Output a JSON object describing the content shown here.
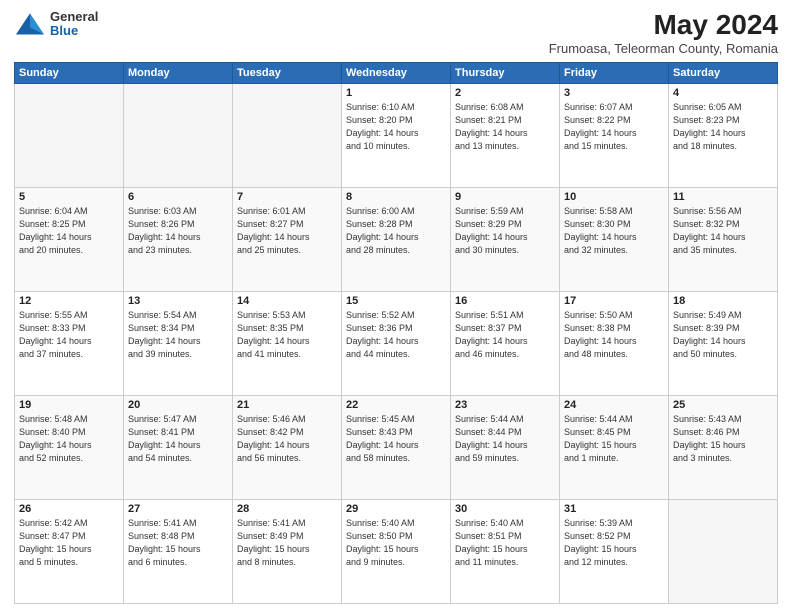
{
  "logo": {
    "general": "General",
    "blue": "Blue"
  },
  "header": {
    "month": "May 2024",
    "location": "Frumoasa, Teleorman County, Romania"
  },
  "weekdays": [
    "Sunday",
    "Monday",
    "Tuesday",
    "Wednesday",
    "Thursday",
    "Friday",
    "Saturday"
  ],
  "weeks": [
    [
      {
        "day": "",
        "info": ""
      },
      {
        "day": "",
        "info": ""
      },
      {
        "day": "",
        "info": ""
      },
      {
        "day": "1",
        "info": "Sunrise: 6:10 AM\nSunset: 8:20 PM\nDaylight: 14 hours\nand 10 minutes."
      },
      {
        "day": "2",
        "info": "Sunrise: 6:08 AM\nSunset: 8:21 PM\nDaylight: 14 hours\nand 13 minutes."
      },
      {
        "day": "3",
        "info": "Sunrise: 6:07 AM\nSunset: 8:22 PM\nDaylight: 14 hours\nand 15 minutes."
      },
      {
        "day": "4",
        "info": "Sunrise: 6:05 AM\nSunset: 8:23 PM\nDaylight: 14 hours\nand 18 minutes."
      }
    ],
    [
      {
        "day": "5",
        "info": "Sunrise: 6:04 AM\nSunset: 8:25 PM\nDaylight: 14 hours\nand 20 minutes."
      },
      {
        "day": "6",
        "info": "Sunrise: 6:03 AM\nSunset: 8:26 PM\nDaylight: 14 hours\nand 23 minutes."
      },
      {
        "day": "7",
        "info": "Sunrise: 6:01 AM\nSunset: 8:27 PM\nDaylight: 14 hours\nand 25 minutes."
      },
      {
        "day": "8",
        "info": "Sunrise: 6:00 AM\nSunset: 8:28 PM\nDaylight: 14 hours\nand 28 minutes."
      },
      {
        "day": "9",
        "info": "Sunrise: 5:59 AM\nSunset: 8:29 PM\nDaylight: 14 hours\nand 30 minutes."
      },
      {
        "day": "10",
        "info": "Sunrise: 5:58 AM\nSunset: 8:30 PM\nDaylight: 14 hours\nand 32 minutes."
      },
      {
        "day": "11",
        "info": "Sunrise: 5:56 AM\nSunset: 8:32 PM\nDaylight: 14 hours\nand 35 minutes."
      }
    ],
    [
      {
        "day": "12",
        "info": "Sunrise: 5:55 AM\nSunset: 8:33 PM\nDaylight: 14 hours\nand 37 minutes."
      },
      {
        "day": "13",
        "info": "Sunrise: 5:54 AM\nSunset: 8:34 PM\nDaylight: 14 hours\nand 39 minutes."
      },
      {
        "day": "14",
        "info": "Sunrise: 5:53 AM\nSunset: 8:35 PM\nDaylight: 14 hours\nand 41 minutes."
      },
      {
        "day": "15",
        "info": "Sunrise: 5:52 AM\nSunset: 8:36 PM\nDaylight: 14 hours\nand 44 minutes."
      },
      {
        "day": "16",
        "info": "Sunrise: 5:51 AM\nSunset: 8:37 PM\nDaylight: 14 hours\nand 46 minutes."
      },
      {
        "day": "17",
        "info": "Sunrise: 5:50 AM\nSunset: 8:38 PM\nDaylight: 14 hours\nand 48 minutes."
      },
      {
        "day": "18",
        "info": "Sunrise: 5:49 AM\nSunset: 8:39 PM\nDaylight: 14 hours\nand 50 minutes."
      }
    ],
    [
      {
        "day": "19",
        "info": "Sunrise: 5:48 AM\nSunset: 8:40 PM\nDaylight: 14 hours\nand 52 minutes."
      },
      {
        "day": "20",
        "info": "Sunrise: 5:47 AM\nSunset: 8:41 PM\nDaylight: 14 hours\nand 54 minutes."
      },
      {
        "day": "21",
        "info": "Sunrise: 5:46 AM\nSunset: 8:42 PM\nDaylight: 14 hours\nand 56 minutes."
      },
      {
        "day": "22",
        "info": "Sunrise: 5:45 AM\nSunset: 8:43 PM\nDaylight: 14 hours\nand 58 minutes."
      },
      {
        "day": "23",
        "info": "Sunrise: 5:44 AM\nSunset: 8:44 PM\nDaylight: 14 hours\nand 59 minutes."
      },
      {
        "day": "24",
        "info": "Sunrise: 5:44 AM\nSunset: 8:45 PM\nDaylight: 15 hours\nand 1 minute."
      },
      {
        "day": "25",
        "info": "Sunrise: 5:43 AM\nSunset: 8:46 PM\nDaylight: 15 hours\nand 3 minutes."
      }
    ],
    [
      {
        "day": "26",
        "info": "Sunrise: 5:42 AM\nSunset: 8:47 PM\nDaylight: 15 hours\nand 5 minutes."
      },
      {
        "day": "27",
        "info": "Sunrise: 5:41 AM\nSunset: 8:48 PM\nDaylight: 15 hours\nand 6 minutes."
      },
      {
        "day": "28",
        "info": "Sunrise: 5:41 AM\nSunset: 8:49 PM\nDaylight: 15 hours\nand 8 minutes."
      },
      {
        "day": "29",
        "info": "Sunrise: 5:40 AM\nSunset: 8:50 PM\nDaylight: 15 hours\nand 9 minutes."
      },
      {
        "day": "30",
        "info": "Sunrise: 5:40 AM\nSunset: 8:51 PM\nDaylight: 15 hours\nand 11 minutes."
      },
      {
        "day": "31",
        "info": "Sunrise: 5:39 AM\nSunset: 8:52 PM\nDaylight: 15 hours\nand 12 minutes."
      },
      {
        "day": "",
        "info": ""
      }
    ]
  ]
}
